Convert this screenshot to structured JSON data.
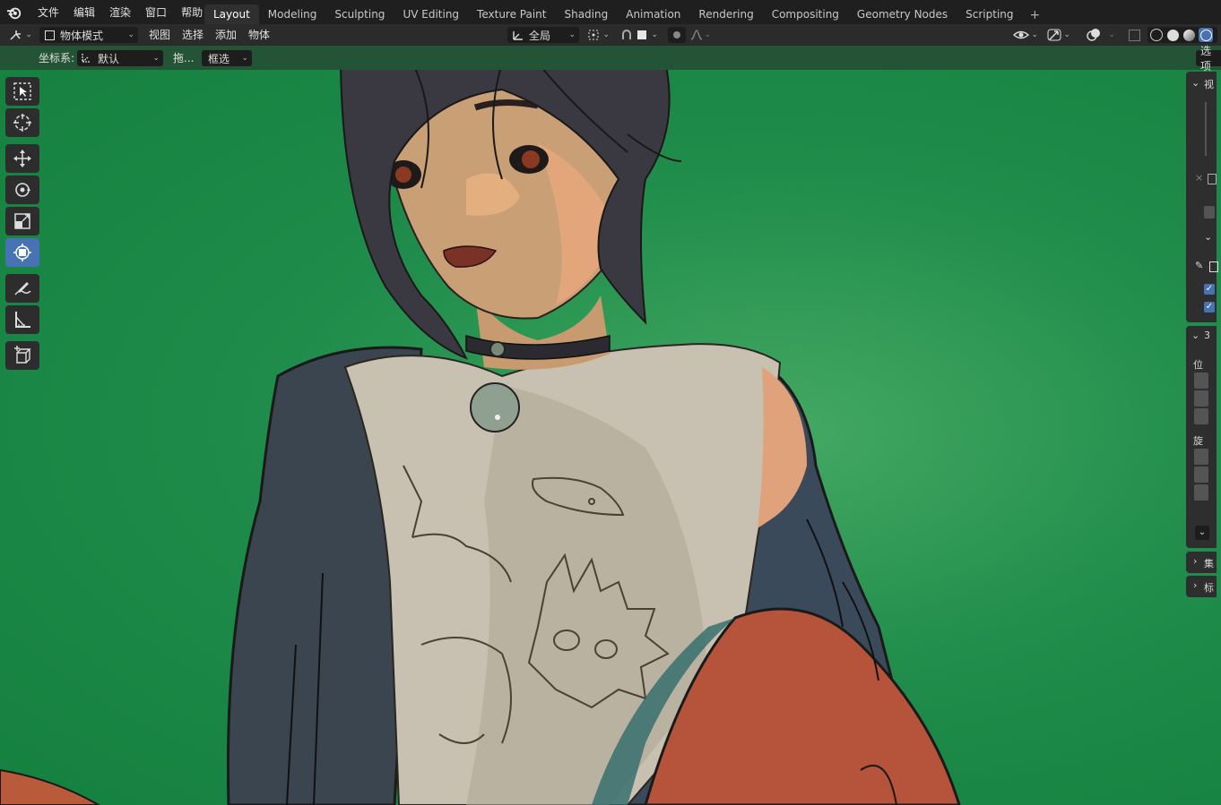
{
  "top_menu": [
    "文件",
    "编辑",
    "渲染",
    "窗口",
    "帮助"
  ],
  "workspace_tabs": [
    {
      "label": "Layout",
      "active": true
    },
    {
      "label": "Modeling",
      "active": false
    },
    {
      "label": "Sculpting",
      "active": false
    },
    {
      "label": "UV Editing",
      "active": false
    },
    {
      "label": "Texture Paint",
      "active": false
    },
    {
      "label": "Shading",
      "active": false
    },
    {
      "label": "Animation",
      "active": false
    },
    {
      "label": "Rendering",
      "active": false
    },
    {
      "label": "Compositing",
      "active": false
    },
    {
      "label": "Geometry Nodes",
      "active": false
    },
    {
      "label": "Scripting",
      "active": false
    }
  ],
  "tab_add": "+",
  "header": {
    "mode": "物体模式",
    "menus": [
      "视图",
      "选择",
      "添加",
      "物体"
    ],
    "transform_orientation": "全局"
  },
  "tool_header": {
    "coord_label": "坐标系:",
    "coord_value": "默认",
    "drag_label": "拖...",
    "select_mode": "框选",
    "options": "选项"
  },
  "sidebar": {
    "view_tab": "视",
    "transform_tab": "3",
    "location_label": "位",
    "rotation_label": "旋",
    "collection_tab": "集",
    "annotation_tab": "标"
  },
  "tools": [
    "select-box",
    "cursor",
    "move",
    "rotate",
    "scale",
    "transform",
    "annotate",
    "measure",
    "add-cube"
  ],
  "colors": {
    "accent": "#4772b3",
    "viewport_bg": "#1e8a48",
    "topbar": "#1f1f1f",
    "header": "#2b2b2b"
  }
}
